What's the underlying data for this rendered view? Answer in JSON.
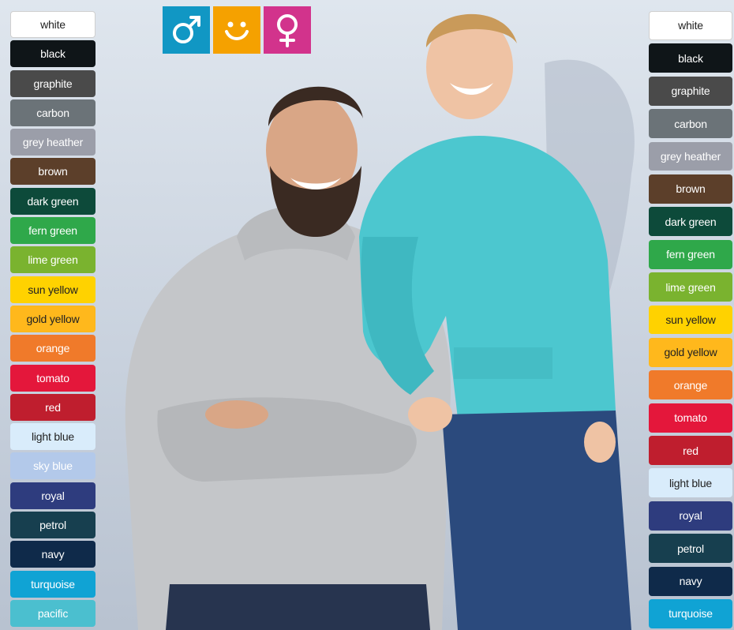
{
  "colors": [
    {
      "label": "white",
      "bg": "#ffffff",
      "fg": "#222222",
      "border": "#cfcfcf"
    },
    {
      "label": "black",
      "bg": "#0f1518",
      "fg": "#ffffff"
    },
    {
      "label": "graphite",
      "bg": "#4a4a4a",
      "fg": "#ffffff"
    },
    {
      "label": "carbon",
      "bg": "#6b7378",
      "fg": "#ffffff"
    },
    {
      "label": "grey heather",
      "bg": "#9b9ea9",
      "fg": "#ffffff"
    },
    {
      "label": "brown",
      "bg": "#5c3f2a",
      "fg": "#ffffff"
    },
    {
      "label": "dark green",
      "bg": "#0d4a3a",
      "fg": "#ffffff"
    },
    {
      "label": "fern green",
      "bg": "#2fa84a",
      "fg": "#ffffff"
    },
    {
      "label": "lime green",
      "bg": "#7ab32f",
      "fg": "#ffffff"
    },
    {
      "label": "sun yellow",
      "bg": "#ffd200",
      "fg": "#222222"
    },
    {
      "label": "gold yellow",
      "bg": "#ffb81c",
      "fg": "#222222"
    },
    {
      "label": "orange",
      "bg": "#f07a2a",
      "fg": "#ffffff"
    },
    {
      "label": "tomato",
      "bg": "#e4173b",
      "fg": "#ffffff"
    },
    {
      "label": "red",
      "bg": "#bf1e2e",
      "fg": "#ffffff"
    },
    {
      "label": "light blue",
      "bg": "#d9ecfb",
      "fg": "#222222"
    },
    {
      "label": "sky blue",
      "bg": "#b3c9ea",
      "fg": "#ffffff"
    },
    {
      "label": "royal",
      "bg": "#2e3c7e",
      "fg": "#ffffff"
    },
    {
      "label": "petrol",
      "bg": "#173f4f",
      "fg": "#ffffff"
    },
    {
      "label": "navy",
      "bg": "#0f2a4a",
      "fg": "#ffffff"
    },
    {
      "label": "turquoise",
      "bg": "#10a3d4",
      "fg": "#ffffff"
    },
    {
      "label": "pacific",
      "bg": "#4bbfcf",
      "fg": "#ffffff"
    }
  ],
  "right_colors": [
    {
      "label": "white",
      "bg": "#ffffff",
      "fg": "#222222",
      "border": "#cfcfcf"
    },
    {
      "label": "black",
      "bg": "#0f1518",
      "fg": "#ffffff"
    },
    {
      "label": "graphite",
      "bg": "#4a4a4a",
      "fg": "#ffffff"
    },
    {
      "label": "carbon",
      "bg": "#6b7378",
      "fg": "#ffffff"
    },
    {
      "label": "grey heather",
      "bg": "#9b9ea9",
      "fg": "#ffffff"
    },
    {
      "label": "brown",
      "bg": "#5c3f2a",
      "fg": "#ffffff"
    },
    {
      "label": "dark green",
      "bg": "#0d4a3a",
      "fg": "#ffffff"
    },
    {
      "label": "fern green",
      "bg": "#2fa84a",
      "fg": "#ffffff"
    },
    {
      "label": "lime green",
      "bg": "#7ab32f",
      "fg": "#ffffff"
    },
    {
      "label": "sun yellow",
      "bg": "#ffd200",
      "fg": "#222222"
    },
    {
      "label": "gold yellow",
      "bg": "#ffb81c",
      "fg": "#222222"
    },
    {
      "label": "orange",
      "bg": "#f07a2a",
      "fg": "#ffffff"
    },
    {
      "label": "tomato",
      "bg": "#e4173b",
      "fg": "#ffffff"
    },
    {
      "label": "red",
      "bg": "#bf1e2e",
      "fg": "#ffffff"
    },
    {
      "label": "light blue",
      "bg": "#d9ecfb",
      "fg": "#222222"
    },
    {
      "label": "royal",
      "bg": "#2e3c7e",
      "fg": "#ffffff"
    },
    {
      "label": "petrol",
      "bg": "#173f4f",
      "fg": "#ffffff"
    },
    {
      "label": "navy",
      "bg": "#0f2a4a",
      "fg": "#ffffff"
    },
    {
      "label": "turquoise",
      "bg": "#10a3d4",
      "fg": "#ffffff"
    }
  ],
  "gender_icons": [
    {
      "icon": "male-icon",
      "bg": "#1197c4"
    },
    {
      "icon": "kids-smiley-icon",
      "bg": "#f5a100"
    },
    {
      "icon": "female-icon",
      "bg": "#d2338c"
    }
  ]
}
